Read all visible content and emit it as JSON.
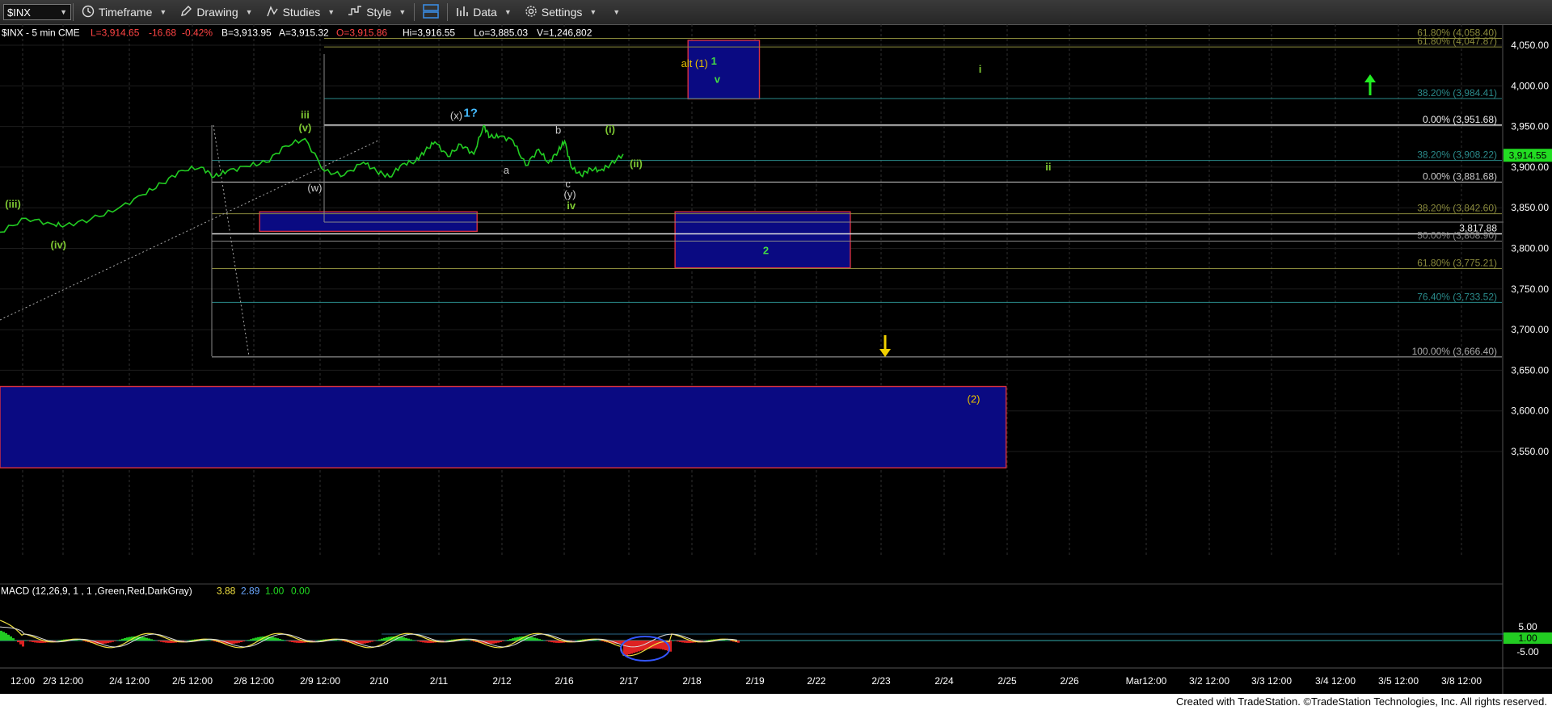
{
  "toolbar": {
    "symbol": "$INX",
    "timeframe": "Timeframe",
    "drawing": "Drawing",
    "studies": "Studies",
    "style": "Style",
    "data": "Data",
    "settings": "Settings"
  },
  "quote": {
    "symbol_line": "$INX - 5 min  CME",
    "last": "L=3,914.65",
    "change": "-16.68",
    "change_pct": "-0.42%",
    "bid": "B=3,913.95",
    "ask": "A=3,915.32",
    "open": "O=3,915.86",
    "high": "Hi=3,916.55",
    "low": "Lo=3,885.03",
    "volume": "V=1,246,802"
  },
  "macd": {
    "label": "MACD (12,26,9, 1 , 1 ,Green,Red,DarkGray)",
    "v1": "3.88",
    "v2": "2.89",
    "v3": "1.00",
    "v4": "0.00",
    "scale": [
      "5.00",
      "1.00",
      "-5.00"
    ]
  },
  "footer": "Created with TradeStation. ©TradeStation Technologies, Inc. All rights reserved.",
  "chart_data": {
    "type": "line",
    "title": "$INX - 5 min",
    "ylim": [
      3510,
      4075
    ],
    "y_ticks": [
      "4,050.00",
      "4,000.00",
      "3,950.00",
      "3,900.00",
      "3,850.00",
      "3,800.00",
      "3,750.00",
      "3,700.00",
      "3,650.00",
      "3,600.00",
      "3,550.00"
    ],
    "y_tick_values": [
      4050,
      4000,
      3950,
      3900,
      3850,
      3800,
      3750,
      3700,
      3650,
      3600,
      3550
    ],
    "x_ticks": [
      "12:00",
      "2/3 12:00",
      "2/4 12:00",
      "2/5 12:00",
      "2/8 12:00",
      "2/9 12:00",
      "2/10",
      "2/11",
      "2/12",
      "2/16",
      "2/17",
      "2/18",
      "2/19",
      "2/22",
      "2/23",
      "2/24",
      "2/25",
      "2/26",
      "Mar12:00",
      "3/2 12:00",
      "3/3 12:00",
      "3/4 12:00",
      "3/5 12:00",
      "3/8 12:00"
    ],
    "last_price": "3,914.55",
    "series": [
      {
        "color": "#22cc22",
        "x": [
          0,
          4,
          8,
          10,
          14,
          18,
          22,
          25,
          28,
          31,
          33,
          35,
          38,
          41,
          44,
          47,
          50,
          53,
          56,
          58,
          60,
          62,
          64,
          65.5,
          67,
          69,
          71,
          73,
          74.5,
          75.5,
          77,
          79,
          81,
          83,
          84.5,
          86,
          87,
          88,
          89.5,
          91,
          92.5,
          94,
          96
        ],
        "values": [
          3820,
          3837,
          3830,
          3828,
          3836,
          3848,
          3866,
          3880,
          3896,
          3900,
          3888,
          3895,
          3901,
          3906,
          3926,
          3935,
          3895,
          3890,
          3906,
          3895,
          3888,
          3904,
          3907,
          3920,
          3931,
          3913,
          3928,
          3916,
          3951,
          3937,
          3938,
          3933,
          3902,
          3922,
          3905,
          3920,
          3932,
          3900,
          3890,
          3898,
          3896,
          3903,
          3916
        ]
      }
    ],
    "fib_levels": [
      {
        "label": "61.80% (4,058.40)",
        "value": 4058.4,
        "color": "#8a8a3c"
      },
      {
        "label": "61.80% (4,047.87)",
        "value": 4047.87,
        "color": "#8a8a3c"
      },
      {
        "label": "38.20% (3,984.41)",
        "value": 3984.41,
        "color": "#2a8a8a"
      },
      {
        "label": "0.00% (3,951.68)",
        "value": 3951.68,
        "color": "#dddddd"
      },
      {
        "label": "38.20% (3,908.22)",
        "value": 3908.22,
        "color": "#2a8a8a"
      },
      {
        "label": "0.00% (3,881.68)",
        "value": 3881.68,
        "color": "#cccccc"
      },
      {
        "label": "38.20% (3,842.60)",
        "value": 3842.6,
        "color": "#8a8a3c"
      },
      {
        "label": "3,817.88",
        "value": 3817.88,
        "color": "#dddddd"
      },
      {
        "label": "50.00% (3,808.90)",
        "value": 3808.9,
        "color": "#888888"
      },
      {
        "label": "61.80% (3,775.21)",
        "value": 3775.21,
        "color": "#8a8a3c"
      },
      {
        "label": "76.40% (3,733.52)",
        "value": 3733.52,
        "color": "#2a8a8a"
      },
      {
        "label": "100.00% (3,666.40)",
        "value": 3666.4,
        "color": "#aaaaaa"
      }
    ],
    "annotations": [
      {
        "text": "(iii)",
        "x": 2,
        "y": 3850,
        "color": "#7ec832"
      },
      {
        "text": "(iv)",
        "x": 9,
        "y": 3800,
        "color": "#7ec832"
      },
      {
        "text": "iii",
        "x": 47,
        "y": 3960,
        "color": "#7ec832"
      },
      {
        "text": "(v)",
        "x": 47,
        "y": 3944,
        "color": "#7ec832"
      },
      {
        "text": "(w)",
        "x": 48.5,
        "y": 3870,
        "color": "#cccccc"
      },
      {
        "text": "(x)",
        "x": 70.3,
        "y": 3959,
        "color": "#cccccc"
      },
      {
        "text": "1?",
        "x": 72.5,
        "y": 3962,
        "color": "#44bbff"
      },
      {
        "text": "a",
        "x": 78,
        "y": 3892,
        "color": "#cccccc"
      },
      {
        "text": "b",
        "x": 86,
        "y": 3941,
        "color": "#cccccc"
      },
      {
        "text": "c",
        "x": 87.5,
        "y": 3875,
        "color": "#cccccc"
      },
      {
        "text": "(y)",
        "x": 87.8,
        "y": 3862,
        "color": "#cccccc"
      },
      {
        "text": "iv",
        "x": 88,
        "y": 3848,
        "color": "#7ec832"
      },
      {
        "text": "(i)",
        "x": 94,
        "y": 3942,
        "color": "#7ec832"
      },
      {
        "text": "(ii)",
        "x": 98,
        "y": 3900,
        "color": "#7ec832"
      },
      {
        "text": "alt (1)",
        "x": 107,
        "y": 4023,
        "color": "#e8c000"
      },
      {
        "text": "1",
        "x": 110,
        "y": 4026,
        "color": "#44dd44"
      },
      {
        "text": "v",
        "x": 110.5,
        "y": 4004,
        "color": "#44dd44"
      },
      {
        "text": "2",
        "x": 118,
        "y": 3793,
        "color": "#44dd44"
      },
      {
        "text": "i",
        "x": 151,
        "y": 4016,
        "color": "#7ec832"
      },
      {
        "text": "ii",
        "x": 161.5,
        "y": 3896,
        "color": "#7ec832"
      },
      {
        "text": "(2)",
        "x": 150,
        "y": 3610,
        "color": "#e8c000"
      }
    ],
    "boxes": [
      {
        "x0": 106,
        "x1": 117,
        "y0": 3984,
        "y1": 4056
      },
      {
        "x0": 40,
        "x1": 73.5,
        "y0": 3821,
        "y1": 3845
      },
      {
        "x0": 104,
        "x1": 131,
        "y0": 3776,
        "y1": 3845
      },
      {
        "x0": 0,
        "x1": 155,
        "y0": 3530,
        "y1": 3630
      }
    ],
    "grid": true,
    "legend": "none"
  }
}
